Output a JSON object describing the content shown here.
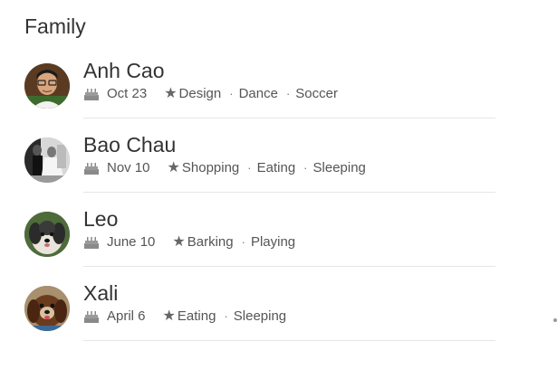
{
  "section": {
    "title": "Family"
  },
  "members": [
    {
      "name": "Anh Cao",
      "birthday": "Oct 23",
      "interests": [
        "Design",
        "Dance",
        "Soccer"
      ],
      "avatar_icon": "person-photo"
    },
    {
      "name": "Bao Chau",
      "birthday": "Nov 10",
      "interests": [
        "Shopping",
        "Eating",
        "Sleeping"
      ],
      "avatar_icon": "wedding-photo"
    },
    {
      "name": "Leo",
      "birthday": "June 10",
      "interests": [
        "Barking",
        "Playing"
      ],
      "avatar_icon": "dog-photo"
    },
    {
      "name": "Xali",
      "birthday": "April 6",
      "interests": [
        "Eating",
        "Sleeping"
      ],
      "avatar_icon": "dog-photo"
    }
  ],
  "icons": {
    "birthday": "cake-icon",
    "interests": "star-icon"
  },
  "colors": {
    "text": "#333333",
    "meta": "#555555",
    "divider": "#e6e6e6"
  }
}
